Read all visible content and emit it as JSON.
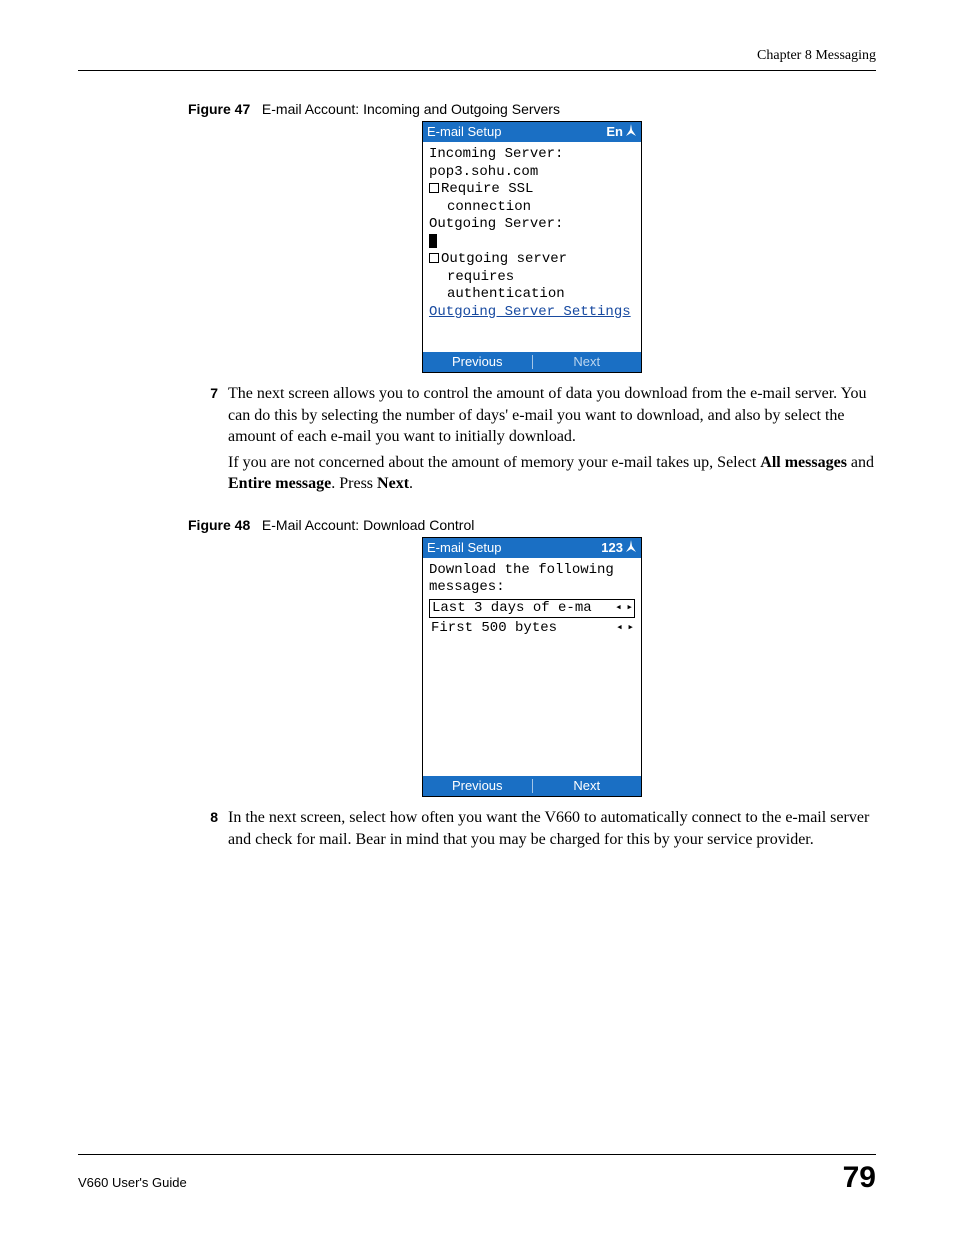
{
  "header": {
    "chapter": "Chapter 8 Messaging"
  },
  "figure47": {
    "caption_label": "Figure 47",
    "caption_text": "E-mail Account: Incoming and Outgoing Servers",
    "title": "E-mail Setup",
    "mode": "En",
    "incoming_label": "Incoming Server:",
    "incoming_value": "pop3.sohu.com",
    "require_ssl": "Require SSL",
    "connection": "connection",
    "outgoing_label": "Outgoing Server:",
    "outgoing_auth1": "Outgoing server",
    "outgoing_auth2": "requires",
    "outgoing_auth3": "authentication",
    "settings_link": "Outgoing Server Settings",
    "prev": "Previous",
    "next": "Next"
  },
  "step7": {
    "num": "7",
    "p1": "The next screen allows you to control the amount of data you download from the e-mail server. You can do this by selecting the number of days' e-mail you want to download, and also by select the amount of each e-mail you want to initially download.",
    "p2a": "If you are not concerned about the amount of memory your e-mail takes up, Select ",
    "p2b": "All messages",
    "p2c": " and ",
    "p2d": "Entire message",
    "p2e": ". Press ",
    "p2f": "Next",
    "p2g": "."
  },
  "figure48": {
    "caption_label": "Figure 48",
    "caption_text": "E-Mail Account: Download Control",
    "title": "E-mail Setup",
    "mode": "123",
    "prompt1": "Download the following",
    "prompt2": "messages:",
    "option1": "Last 3 days of e-ma",
    "option2": "First 500 bytes",
    "prev": "Previous",
    "next": "Next"
  },
  "step8": {
    "num": "8",
    "p1": "In the next screen, select how often you want the V660 to automatically connect to the e-mail server and check for mail. Bear in mind that you may be charged for this by your service provider."
  },
  "footer": {
    "guide": "V660 User's Guide",
    "page": "79"
  }
}
